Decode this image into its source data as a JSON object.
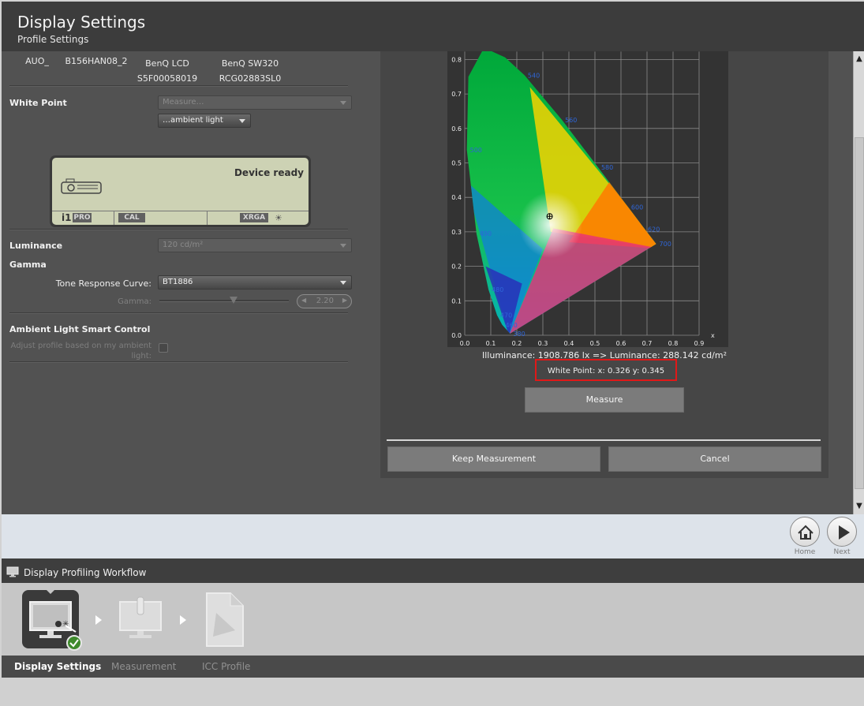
{
  "header": {
    "title": "Display Settings",
    "subtitle": "Profile Settings"
  },
  "devices": [
    {
      "line1": "AUO_",
      "line2": ""
    },
    {
      "line1": "B156HAN08_2",
      "line2": ""
    },
    {
      "line1": "BenQ LCD",
      "line2": "S5F00058019"
    },
    {
      "line1": "BenQ SW320",
      "line2": "RCG02883SL0"
    }
  ],
  "white_point": {
    "label": "White Point",
    "measure_select": "Measure…",
    "source_select": "…ambient light"
  },
  "device_lcd": {
    "status": "Device ready",
    "chip_pro": "PRO",
    "chip_cal": "CAL",
    "chip_xrga": "XRGA",
    "brand": "i1"
  },
  "luminance": {
    "label": "Luminance",
    "value": "120 cd/m²"
  },
  "gamma": {
    "label": "Gamma",
    "tone_curve_label": "Tone Response Curve:",
    "tone_curve_value": "BT1886",
    "gamma_label": "Gamma:",
    "gamma_value": "2.20",
    "gamma_fraction": 0.58
  },
  "ambient": {
    "label": "Ambient Light Smart Control",
    "checkbox_label_1": "Adjust profile based on my ambient",
    "checkbox_label_2": "light:"
  },
  "chart_data": {
    "type": "scatter",
    "title": "",
    "xlabel": "x",
    "ylabel": "",
    "xlim": [
      0.0,
      0.9
    ],
    "ylim": [
      0.0,
      0.8
    ],
    "x_ticks": [
      "0.0",
      "0.1",
      "0.2",
      "0.3",
      "0.4",
      "0.5",
      "0.6",
      "0.7",
      "0.8",
      "0.9"
    ],
    "y_ticks": [
      "0.0",
      "0.1",
      "0.2",
      "0.3",
      "0.4",
      "0.5",
      "0.6",
      "0.7",
      "0.8"
    ],
    "grid": true,
    "locus_labels": [
      {
        "text": "380",
        "x": 0.174,
        "y": 0.005
      },
      {
        "text": "460",
        "x": 0.144,
        "y": 0.03
      },
      {
        "text": "470",
        "x": 0.124,
        "y": 0.058
      },
      {
        "text": "480",
        "x": 0.091,
        "y": 0.133
      },
      {
        "text": "490",
        "x": 0.045,
        "y": 0.295
      },
      {
        "text": "500",
        "x": 0.008,
        "y": 0.538
      },
      {
        "text": "540",
        "x": 0.23,
        "y": 0.754
      },
      {
        "text": "560",
        "x": 0.373,
        "y": 0.625
      },
      {
        "text": "580",
        "x": 0.512,
        "y": 0.487
      },
      {
        "text": "600",
        "x": 0.627,
        "y": 0.372
      },
      {
        "text": "620",
        "x": 0.691,
        "y": 0.308
      },
      {
        "text": "700",
        "x": 0.735,
        "y": 0.265
      }
    ],
    "points": [
      {
        "name": "White Point",
        "x": 0.326,
        "y": 0.345
      }
    ]
  },
  "measurement": {
    "illuminance_line": "Illuminance:  1908.786 lx  =>  Luminance:  288.142 cd/m²",
    "white_point_line": "White Point: x: 0.326  y: 0.345",
    "measure_button": "Measure",
    "keep_button": "Keep Measurement",
    "cancel_button": "Cancel"
  },
  "nav": {
    "home": "Home",
    "next": "Next"
  },
  "workflow": {
    "title": "Display Profiling Workflow",
    "tabs": [
      "Display Settings",
      "Measurement",
      "ICC Profile"
    ]
  },
  "colors": {
    "highlight_box": "#e01818",
    "panel": "#525252",
    "header": "#3c3c3c"
  }
}
